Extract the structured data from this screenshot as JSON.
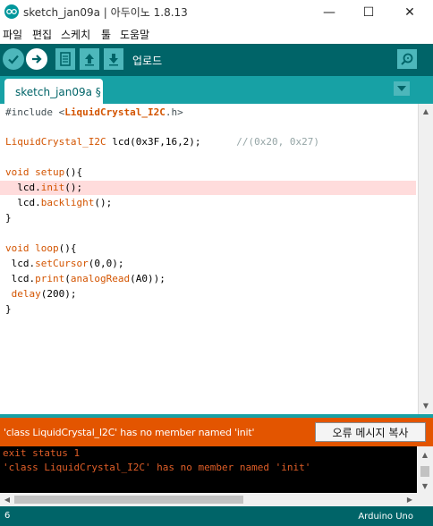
{
  "window": {
    "title": "sketch_jan09a | 아두이노 1.8.13",
    "controls": {
      "minimize": "—",
      "maximize": "☐",
      "close": "✕"
    }
  },
  "menu": {
    "items": [
      "파일",
      "편집",
      "스케치",
      "툴",
      "도움말"
    ]
  },
  "toolbar": {
    "active_label": "업로드",
    "buttons": [
      "verify",
      "upload",
      "new",
      "open",
      "save"
    ]
  },
  "tabs": [
    {
      "label": "sketch_jan09a §"
    }
  ],
  "editor": {
    "lines": [
      "#include <LiquidCrystal_I2C.h>",
      "",
      "LiquidCrystal_I2C lcd(0x3F,16,2);      //(0x20, 0x27)",
      "",
      "void setup(){",
      "  lcd.init();",
      "  lcd.backlight();",
      "}",
      "",
      "void loop(){",
      " lcd.setCursor(0,0);",
      " lcd.print(analogRead(A0));",
      " delay(200);",
      "}"
    ],
    "error_line_index": 5
  },
  "errorbar": {
    "message": "'class LiquidCrystal_I2C' has no member named 'init'",
    "copy_button": "오류 메시지 복사"
  },
  "console": {
    "lines": [
      "exit status 1",
      "'class LiquidCrystal_I2C' has no member named 'init'"
    ]
  },
  "status": {
    "line_number": "6",
    "board": "Arduino Uno"
  },
  "colors": {
    "teal_dark": "#006468",
    "teal_mid": "#17a1a5",
    "teal_light": "#4db7bb",
    "error_orange": "#e35500",
    "console_text": "#e05e28",
    "keyword_orange": "#d35400",
    "error_line_highlight": "#ffdcdc"
  }
}
